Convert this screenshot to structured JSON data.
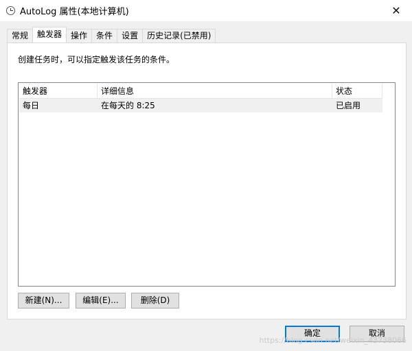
{
  "window": {
    "title": "AutoLog 属性(本地计算机)",
    "icon": "clock-icon",
    "close_glyph": "✕"
  },
  "tabs": [
    {
      "label": "常规"
    },
    {
      "label": "触发器",
      "active": true
    },
    {
      "label": "操作"
    },
    {
      "label": "条件"
    },
    {
      "label": "设置"
    },
    {
      "label": "历史记录(已禁用)"
    }
  ],
  "triggers": {
    "description": "创建任务时，可以指定触发该任务的条件。",
    "columns": [
      "触发器",
      "详细信息",
      "状态"
    ],
    "rows": [
      {
        "trigger": "每日",
        "details": "在每天的 8:25",
        "status": "已启用"
      }
    ],
    "buttons": {
      "new": "新建(N)...",
      "edit": "编辑(E)...",
      "delete": "删除(D)"
    }
  },
  "dialog_buttons": {
    "ok": "确定",
    "cancel": "取消"
  },
  "watermark": "https://blog.csdn.net/weixin_43738066"
}
